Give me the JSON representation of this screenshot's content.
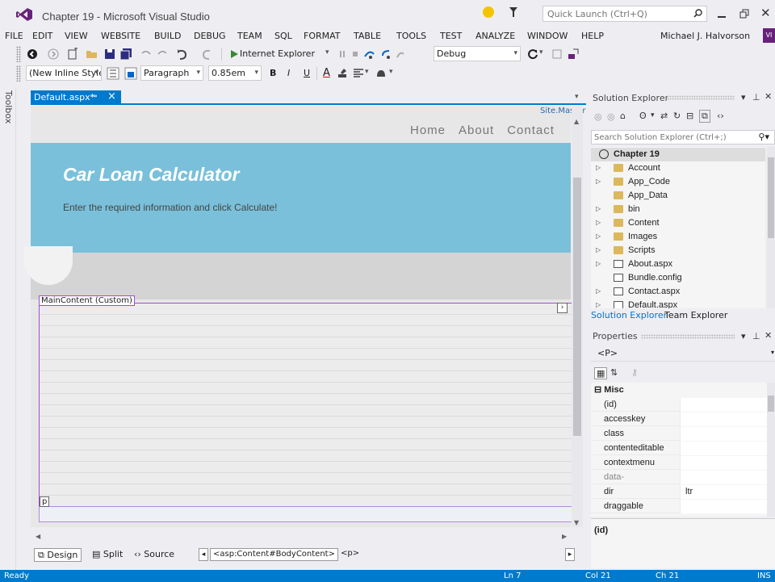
{
  "window": {
    "title": "Chapter 19 - Microsoft Visual Studio",
    "quick_launch_placeholder": "Quick Launch (Ctrl+Q)"
  },
  "menu": {
    "items": [
      "FILE",
      "EDIT",
      "VIEW",
      "WEBSITE",
      "BUILD",
      "DEBUG",
      "TEAM",
      "SQL",
      "FORMAT",
      "TABLE",
      "TOOLS",
      "TEST",
      "ANALYZE",
      "WINDOW",
      "HELP"
    ],
    "user": "Michael J. Halvorson",
    "user_badge": "VI"
  },
  "toolbar1": {
    "browser_label": "Internet Explorer",
    "config_value": "Debug"
  },
  "toolbar2": {
    "style_value": "(New Inline Style",
    "block_value": "Paragraph",
    "size_value": "0.85em",
    "bold": "B",
    "italic": "I",
    "underline": "U",
    "font_color": "A"
  },
  "toolbox": {
    "label": "Toolbox"
  },
  "document": {
    "tab_label": "Default.aspx*",
    "master_label": "Site.Master",
    "nav": [
      "Home",
      "About",
      "Contact"
    ],
    "hero_title": "Car Loan Calculator",
    "hero_subtitle": "Enter the required information and click Calculate!",
    "content_label": "MainContent (Custom)",
    "p_tag": "p"
  },
  "view_tabs": {
    "design": "Design",
    "split": "Split",
    "source": "Source",
    "crumb1": "<asp:Content#BodyContent>",
    "crumb2": "<p>"
  },
  "solution_explorer": {
    "title": "Solution Explorer",
    "search_placeholder": "Search Solution Explorer (Ctrl+;)",
    "root": "Chapter 19",
    "items": [
      {
        "label": "Account",
        "type": "folder",
        "expandable": true
      },
      {
        "label": "App_Code",
        "type": "folder",
        "expandable": true
      },
      {
        "label": "App_Data",
        "type": "folder",
        "expandable": false
      },
      {
        "label": "bin",
        "type": "folder",
        "expandable": true
      },
      {
        "label": "Content",
        "type": "folder",
        "expandable": true
      },
      {
        "label": "Images",
        "type": "folder",
        "expandable": true
      },
      {
        "label": "Scripts",
        "type": "folder",
        "expandable": true
      },
      {
        "label": "About.aspx",
        "type": "page",
        "expandable": true
      },
      {
        "label": "Bundle.config",
        "type": "config",
        "expandable": false
      },
      {
        "label": "Contact.aspx",
        "type": "page",
        "expandable": true
      },
      {
        "label": "Default.aspx",
        "type": "page",
        "expandable": true
      }
    ],
    "tab1": "Solution Explorer",
    "tab2": "Team Explorer"
  },
  "properties": {
    "title": "Properties",
    "selected": "<P>",
    "category": "Misc",
    "rows": [
      {
        "name": "(id)",
        "value": ""
      },
      {
        "name": "accesskey",
        "value": ""
      },
      {
        "name": "class",
        "value": ""
      },
      {
        "name": "contenteditable",
        "value": ""
      },
      {
        "name": "contextmenu",
        "value": ""
      },
      {
        "name": "data-",
        "value": ""
      },
      {
        "name": "dir",
        "value": "ltr"
      },
      {
        "name": "draggable",
        "value": ""
      }
    ],
    "description": "(id)"
  },
  "status": {
    "ready": "Ready",
    "ln": "Ln 7",
    "col": "Col 21",
    "ch": "Ch 21",
    "mode": "INS"
  },
  "colors": {
    "accent": "#007acc",
    "hero": "#7ac0da",
    "content_border": "#9b4fd0",
    "vs_purple": "#68217a"
  }
}
